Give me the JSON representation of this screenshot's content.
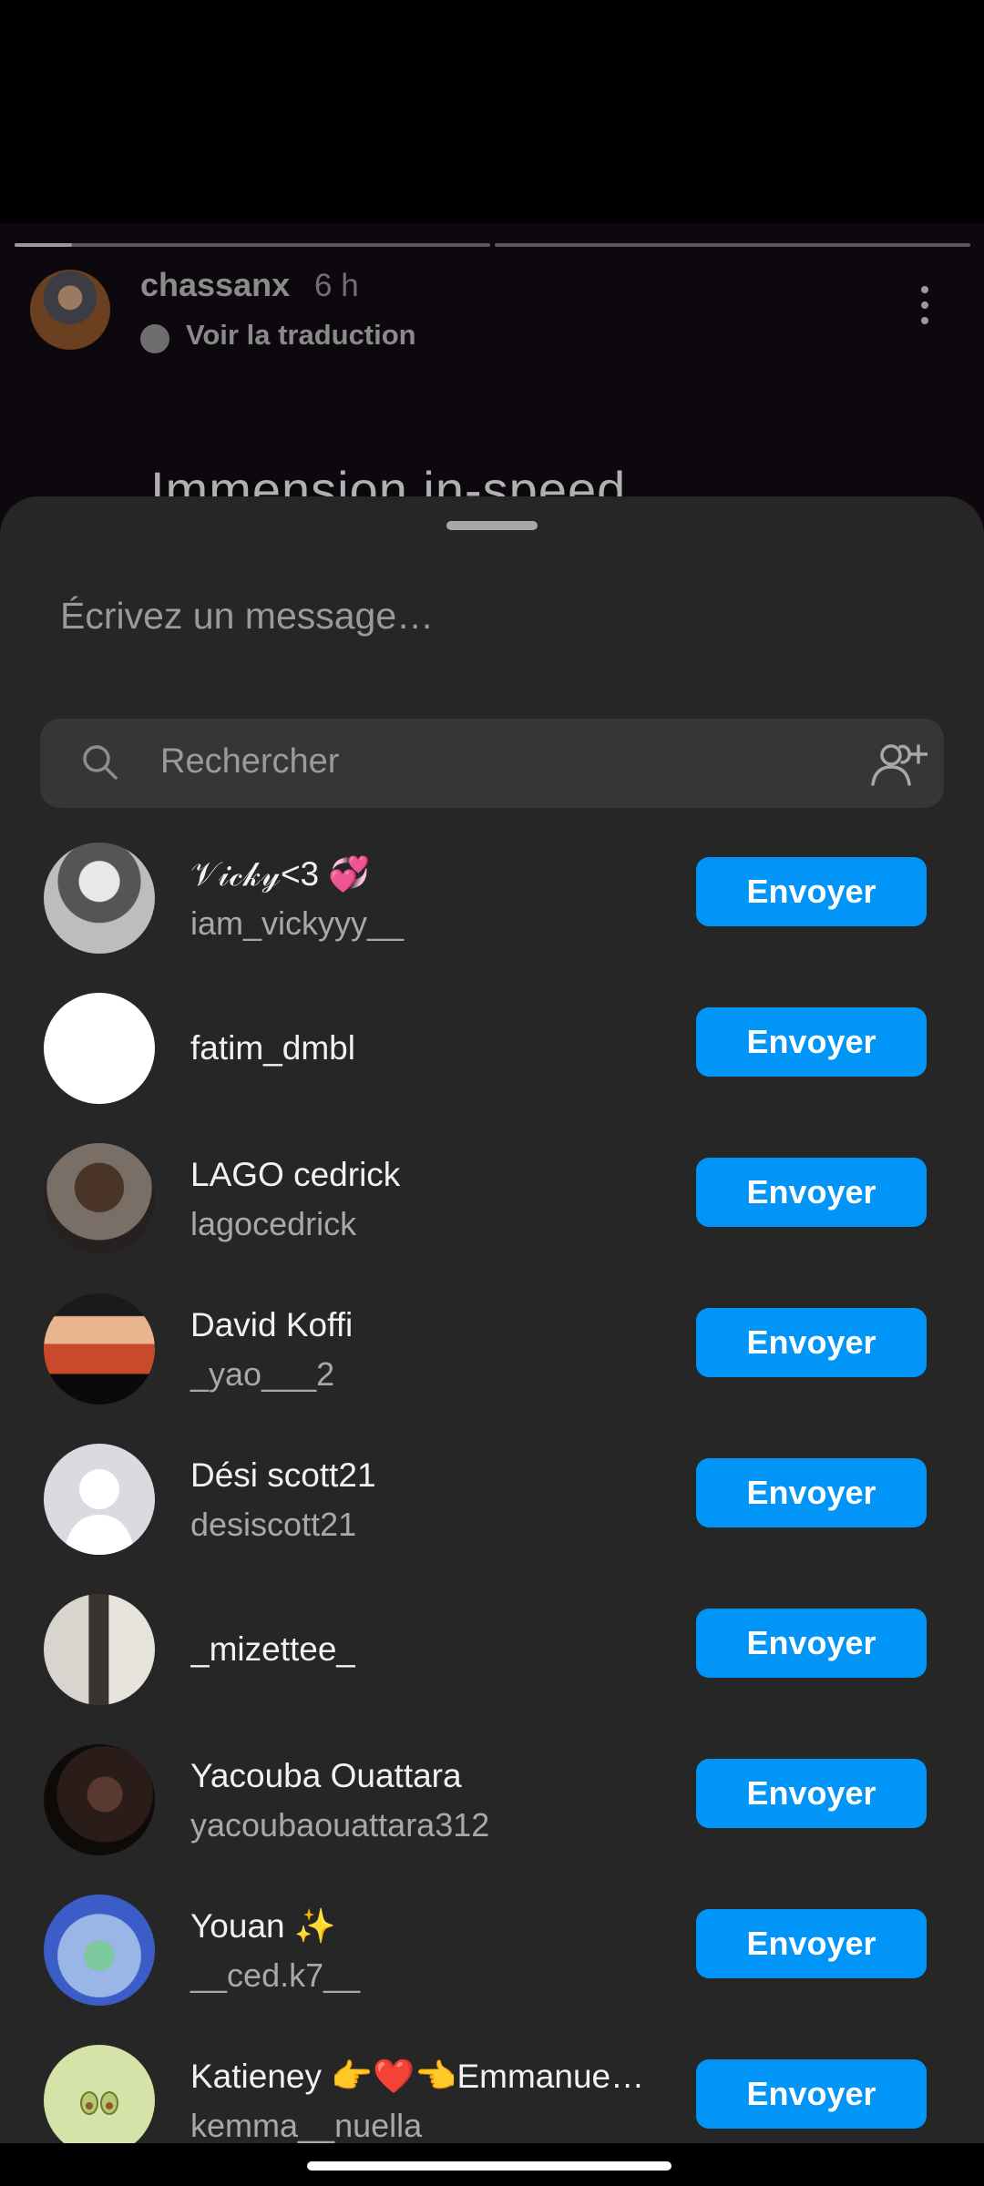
{
  "story": {
    "username": "chassanx",
    "time": "6 h",
    "translate": "Voir la traduction",
    "caption": "Immension in-speed"
  },
  "share_sheet": {
    "message_placeholder": "Écrivez un message…",
    "search_placeholder": "Rechercher",
    "send_label": "Envoyer",
    "contacts": [
      {
        "name": "𝒱𝒾𝒸𝓀𝓎<3 💞",
        "username": "iam_vickyyy__"
      },
      {
        "name": "fatim_dmbl",
        "username": ""
      },
      {
        "name": "LAGO cedrick",
        "username": "lagocedrick"
      },
      {
        "name": "David Koffi",
        "username": "_yao___2"
      },
      {
        "name": "Dési scott21",
        "username": "desiscott21"
      },
      {
        "name": "_mizettee_",
        "username": ""
      },
      {
        "name": "Yacouba Ouattara",
        "username": "yacoubaouattara312"
      },
      {
        "name": "Youan ✨",
        "username": "__ced.k7__"
      },
      {
        "name": "Katieney 👉❤️👈Emmanue…",
        "username": "kemma__nuella"
      }
    ]
  },
  "colors": {
    "accent": "#0095f6",
    "sheet_bg": "#262626",
    "search_bg": "#363636"
  }
}
